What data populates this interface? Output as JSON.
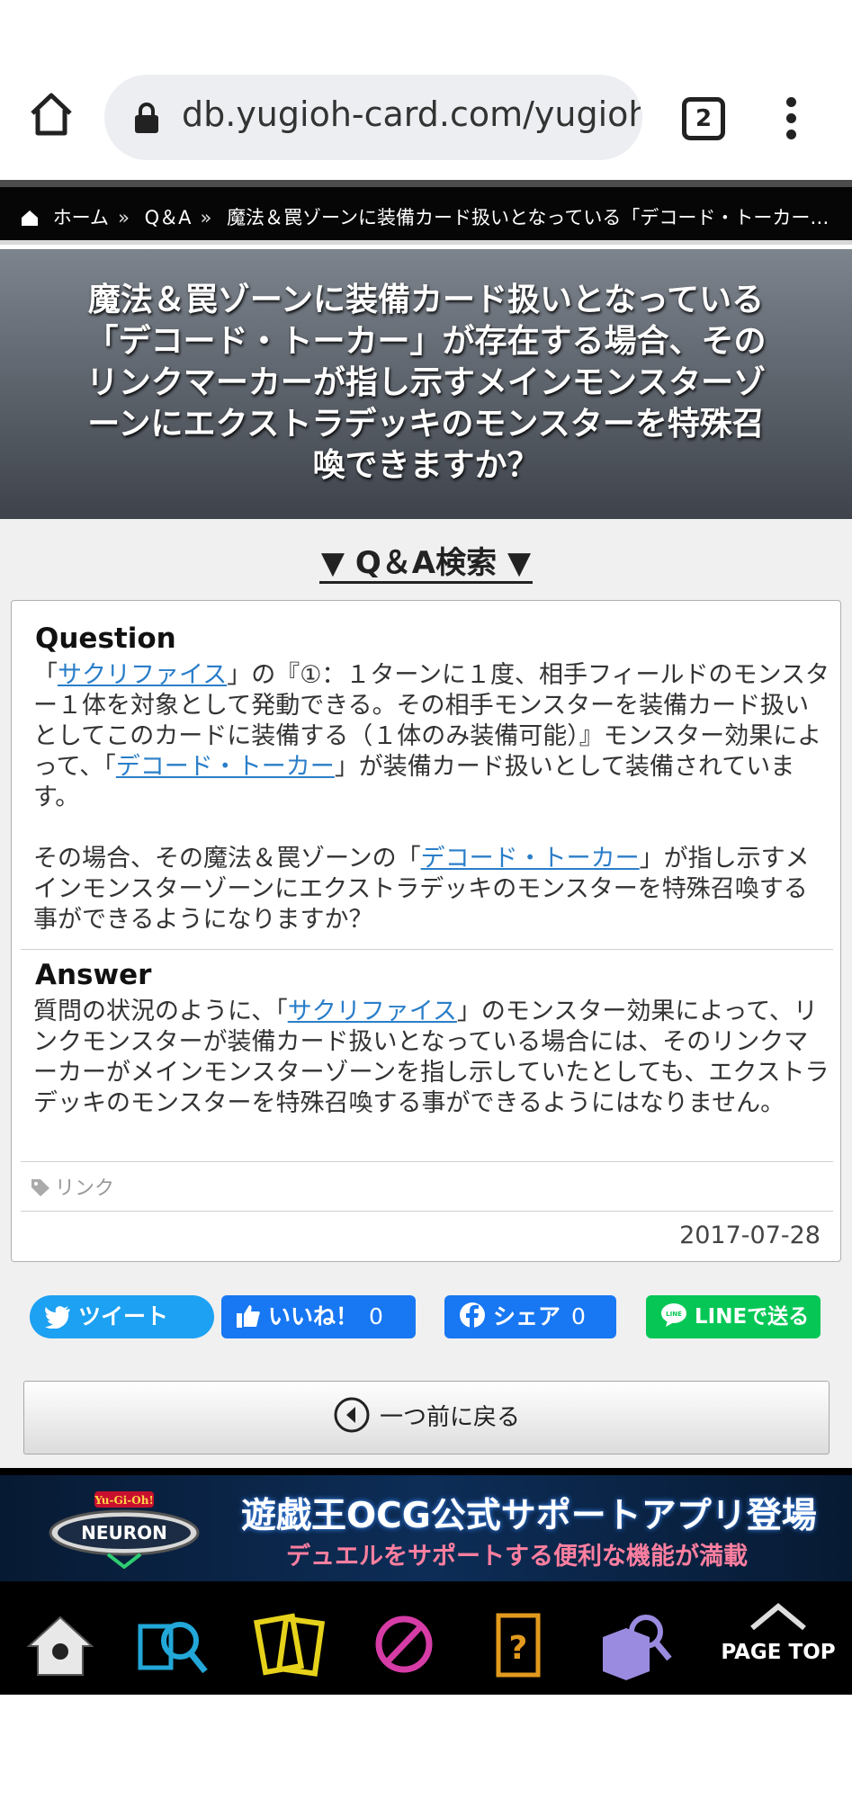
{
  "browser": {
    "url": "db.yugioh-card.com/yugiohdb/faq_search.action",
    "tab_count": "2"
  },
  "breadcrumb": {
    "items": [
      "ホーム",
      "Q＆A",
      "魔法＆罠ゾーンに装備カード扱いとなっている「デコード・トーカー…"
    ],
    "separator": "»"
  },
  "page": {
    "title": "魔法＆罠ゾーンに装備カード扱いとなっている「デコード・トーカー」が存在する場合、そのリンクマーカーが指し示すメインモンスターゾーンにエクストラデッキのモンスターを特殊召喚できますか？",
    "search_toggle": "▼ Q＆A検索 ▼"
  },
  "qa": {
    "question_label": "Question",
    "q_p1_a": "「",
    "q_link1": "サクリファイス",
    "q_p1_b": "」の『①：１ターンに１度、相手フィールドのモンスター１体を対象として発動できる。その相手モンスターを装備カード扱いとしてこのカードに装備する（１体のみ装備可能）』モンスター効果によって、「",
    "q_link2": "デコード・トーカー",
    "q_p1_c": "」が装備カード扱いとして装備されています。",
    "q_p2_a": "その場合、その魔法＆罠ゾーンの「",
    "q_link3": "デコード・トーカー",
    "q_p2_b": "」が指し示すメインモンスターゾーンにエクストラデッキのモンスターを特殊召喚する事ができるようになりますか？",
    "answer_label": "Answer",
    "a_a": "質問の状況のように、「",
    "a_link": "サクリファイス",
    "a_b": "」のモンスター効果によって、リンクモンスターが装備カード扱いとなっている場合には、そのリンクマーカーがメインモンスターゾーンを指し示していたとしても、エクストラデッキのモンスターを特殊召喚する事ができるようにはなりません。",
    "tag": "リンク",
    "date": "2017-07-28"
  },
  "share": {
    "tweet": "ツイート",
    "like": "いいね！",
    "like_count": "0",
    "fb_share": "シェア",
    "fb_share_count": "0",
    "line": "LINEで送る"
  },
  "back_button": "一つ前に戻る",
  "banner": {
    "title": "遊戯王OCG公式サポートアプリ登場",
    "subtitle": "デュエルをサポートする便利な機能が満載"
  },
  "bottom_nav": {
    "page_top": "PAGE TOP"
  },
  "colors": {
    "link": "#2a7ec9",
    "twitter": "#1da1f2",
    "facebook_like": "#1877f2",
    "facebook_share": "#1877f2",
    "line": "#06c755"
  }
}
